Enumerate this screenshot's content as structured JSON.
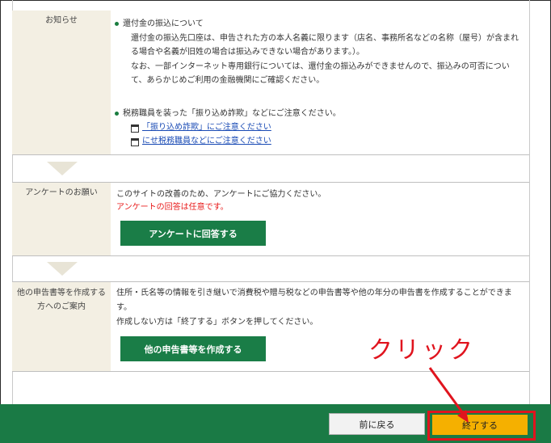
{
  "notice": {
    "label": "お知らせ",
    "item1_title": "還付金の振込について",
    "item1_line1": "還付金の振込先口座は、申告された方の本人名義に限ります（店名、事務所名などの名称（屋号）が含まれ",
    "item1_line2": "る場合や名義が旧姓の場合は振込みできない場合があります。）。",
    "item1_line3": "なお、一部インターネット専用銀行については、還付金の振込みができませんので、振込みの可否につい",
    "item1_line4": "て、あらかじめご利用の金融機関にご確認ください。",
    "item2_title": "税務職員を装った「振り込め詐欺」などにご注意ください。",
    "link1": "「振り込め詐欺」にご注意ください",
    "link2": "にせ税務職員などにご注意ください"
  },
  "survey": {
    "label": "アンケートのお願い",
    "line1": "このサイトの改善のため、アンケートにご協力ください。",
    "note": "アンケートの回答は任意です。",
    "button": "アンケートに回答する"
  },
  "other": {
    "label_line1": "他の申告書等を作成する",
    "label_line2": "方へのご案内",
    "line1": "住所・氏名等の情報を引き継いで消費税や贈与税などの申告書等や他の年分の申告書を作成することができま",
    "line2": "す。",
    "line3": "作成しない方は「終了する」ボタンを押してください。",
    "button": "他の申告書等を作成する"
  },
  "footer": {
    "back": "前に戻る",
    "end": "終了する"
  },
  "annotation": {
    "text": "クリック"
  },
  "colors": {
    "green": "#1a7d47",
    "footer_green": "#1a7a45",
    "orange": "#f5b000",
    "annotation_red": "#e0141e",
    "label_bg": "#f3efe3"
  }
}
